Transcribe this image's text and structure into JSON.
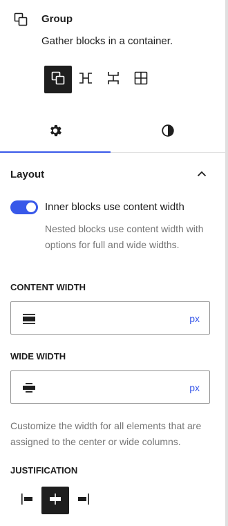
{
  "block": {
    "title": "Group",
    "description": "Gather blocks in a container.",
    "icon": "group-icon"
  },
  "variations": [
    {
      "name": "group-variation-icon",
      "active": true
    },
    {
      "name": "row-variation-icon",
      "active": false
    },
    {
      "name": "stack-variation-icon",
      "active": false
    },
    {
      "name": "grid-variation-icon",
      "active": false
    }
  ],
  "tabs": {
    "settings_icon": "gear-icon",
    "styles_icon": "contrast-icon",
    "active": "settings"
  },
  "layout": {
    "title": "Layout",
    "expanded": true,
    "toggle_label": "Inner blocks use content width",
    "toggle_on": true,
    "toggle_help": "Nested blocks use content width with options for full and wide widths.",
    "content_width": {
      "label": "Content width",
      "value": "",
      "unit": "px"
    },
    "wide_width": {
      "label": "Wide width",
      "value": "",
      "unit": "px"
    },
    "width_help": "Customize the width for all elements that are assigned to the center or wide columns.",
    "justification": {
      "label": "Justification",
      "options": [
        "left",
        "center",
        "right"
      ],
      "selected": "center"
    }
  },
  "colors": {
    "accent": "#3858e9",
    "text": "#1e1e1e",
    "muted": "#757575",
    "border": "#949494"
  }
}
